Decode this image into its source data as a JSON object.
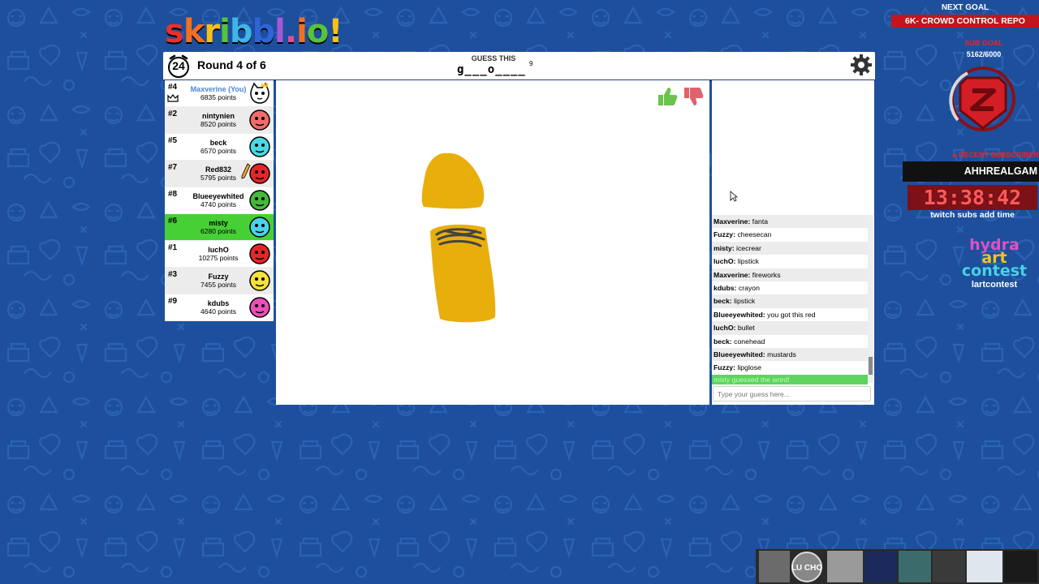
{
  "app": {
    "logo_letters": [
      "s",
      "k",
      "r",
      "i",
      "b",
      "b",
      "l",
      ".",
      "i",
      "o",
      "!"
    ],
    "logo_colors": [
      "#e8312b",
      "#f36f22",
      "#f8c11a",
      "#57c23c",
      "#3fb5e8",
      "#2f64d8",
      "#a458d6",
      "#e64c98",
      "#f36f22",
      "#57c23c",
      "#f8c11a"
    ]
  },
  "topbar": {
    "timer": "24",
    "round": "Round 4 of 6",
    "guess_label": "GUESS THIS",
    "word": "g___o____",
    "word_length": "9"
  },
  "players": [
    {
      "rank": "#4",
      "name": "Maxverine (You)",
      "points": "6835 points",
      "you": true,
      "crown": true,
      "avatar_color": "#ffffff",
      "style": "cat"
    },
    {
      "rank": "#2",
      "name": "nintynien",
      "points": "8520 points",
      "avatar_color": "#f26c6c",
      "style": "face"
    },
    {
      "rank": "#5",
      "name": "beck",
      "points": "6570 points",
      "avatar_color": "#4ad9e4",
      "style": "face"
    },
    {
      "rank": "#7",
      "name": "Red832",
      "points": "5795 points",
      "avatar_color": "#e4262a",
      "style": "face",
      "drawing": true
    },
    {
      "rank": "#8",
      "name": "Blueeyewhited",
      "points": "4740 points",
      "avatar_color": "#46b93b",
      "style": "face"
    },
    {
      "rank": "#6",
      "name": "misty",
      "points": "6280 points",
      "avatar_color": "#49d2ec",
      "style": "face",
      "active": true
    },
    {
      "rank": "#1",
      "name": "luchO",
      "points": "10275 points",
      "avatar_color": "#e22727",
      "style": "face"
    },
    {
      "rank": "#3",
      "name": "Fuzzy",
      "points": "7455 points",
      "avatar_color": "#f5e13a",
      "style": "face"
    },
    {
      "rank": "#9",
      "name": "kdubs",
      "points": "4640 points",
      "avatar_color": "#e94fb7",
      "style": "face"
    }
  ],
  "chat": {
    "messages": [
      {
        "user": "Maxverine:",
        "text": " fanta"
      },
      {
        "user": "Fuzzy:",
        "text": " cheesecan"
      },
      {
        "user": "misty:",
        "text": " icecrear"
      },
      {
        "user": "luchO:",
        "text": " lipstick"
      },
      {
        "user": "Maxverine:",
        "text": " fireworks"
      },
      {
        "user": "kdubs:",
        "text": " crayon"
      },
      {
        "user": "beck:",
        "text": " lipstick"
      },
      {
        "user": "Blueeyewhited:",
        "text": " you got this red"
      },
      {
        "user": "luchO:",
        "text": " bullet"
      },
      {
        "user": "beck:",
        "text": " conehead"
      },
      {
        "user": "Blueeyewhited:",
        "text": " mustards"
      },
      {
        "user": "Fuzzy:",
        "text": " lipglose"
      }
    ],
    "system_message": "misty guessed the word!",
    "input_placeholder": "Type your guess here..."
  },
  "overlay": {
    "next_goal_label": "NEXT GOAL",
    "next_goal_name": "6K- CROWD CONTROL REPO",
    "sub_goal_label": "SUB GOAL",
    "sub_goal_count": "5162/6000",
    "recent_sub_label": "▸ RECENT SUBSCRIBER",
    "recent_sub_name": "AHHREALGAM",
    "timer": "13:38:42",
    "timer_caption": "twitch subs add time",
    "contest_line1": "hydra",
    "contest_line2": "art",
    "contest_line3": "contest",
    "contest_handle": "lartcontest",
    "bottom_text": "LU CHO"
  },
  "colors": {
    "background": "#1d4f9c",
    "active_player": "#47d036",
    "drawing_fill": "#e8ae0c",
    "brand_red": "#c2151d"
  }
}
